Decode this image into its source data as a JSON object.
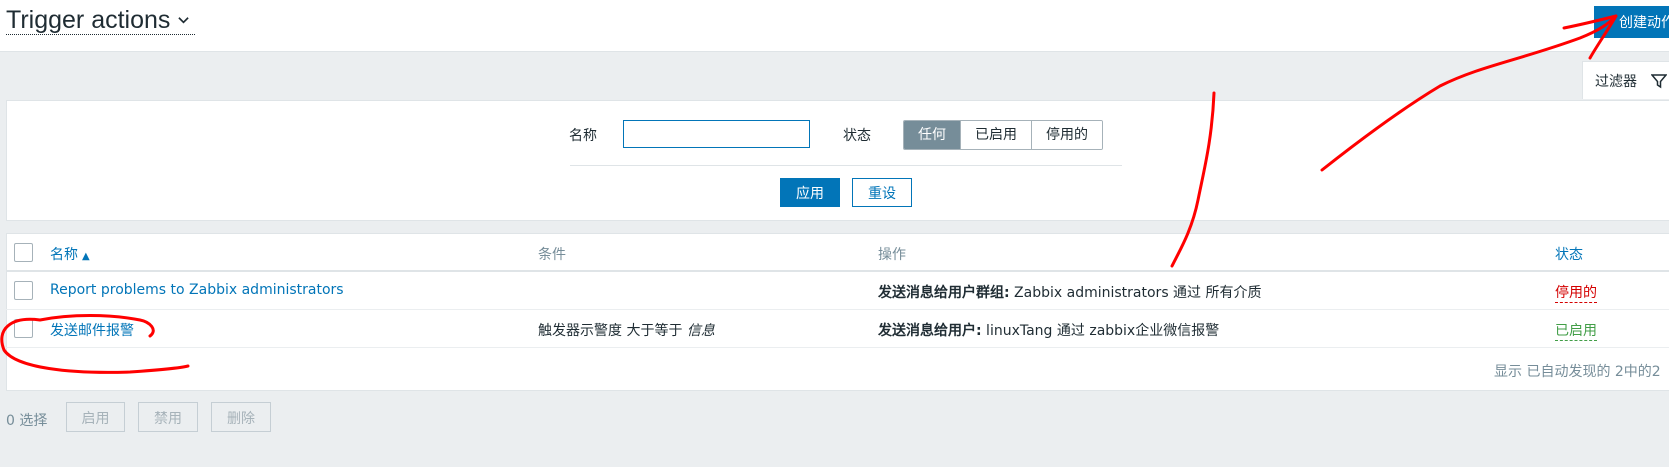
{
  "header": {
    "title": "Trigger actions",
    "create_label": "创建动作"
  },
  "filter": {
    "tab_label": "过滤器",
    "name_label": "名称",
    "name_value": "",
    "status_label": "状态",
    "status_options": [
      "任何",
      "已启用",
      "停用的"
    ],
    "status_selected": "任何",
    "apply_label": "应用",
    "reset_label": "重设"
  },
  "table": {
    "columns": {
      "name": "名称",
      "conditions": "条件",
      "operations": "操作",
      "status": "状态"
    },
    "sort_indicator": "▲",
    "rows": [
      {
        "name": "Report problems to Zabbix administrators",
        "conditions": "",
        "op_label": "发送消息给用户群组:",
        "op_text": " Zabbix administrators 通过 所有介质",
        "status": "停用的"
      },
      {
        "name": "发送邮件报警",
        "cond_prefix": "触发器示警度 大于等于 ",
        "cond_value": "信息",
        "op_label": "发送消息给用户:",
        "op_text": " linuxTang 通过 zabbix企业微信报警",
        "status": "已启用"
      }
    ],
    "footer": "显示 已自动发现的 2中的2"
  },
  "mass": {
    "selected": "0 选择",
    "enable": "启用",
    "disable": "禁用",
    "delete": "删除"
  },
  "colors": {
    "accent": "#0275b8",
    "disabled": "#d40000",
    "enabled": "#429e47",
    "annotation": "#ff0000"
  }
}
